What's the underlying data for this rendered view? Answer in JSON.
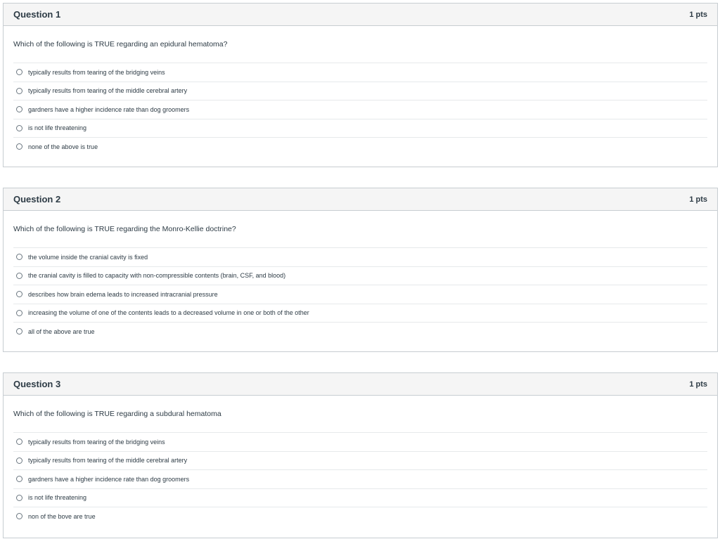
{
  "questions": [
    {
      "title": "Question 1",
      "points": "1 pts",
      "text": "Which of the following is TRUE regarding an epidural hematoma?",
      "answers": [
        "typically results from tearing of the bridging veins",
        "typically results from tearing of the middle cerebral artery",
        "gardners have a higher incidence rate than dog groomers",
        "is not life threatening",
        "none of the above is true"
      ]
    },
    {
      "title": "Question 2",
      "points": "1 pts",
      "text": "Which of the following is TRUE regarding the Monro-Kellie doctrine?",
      "answers": [
        "the volume inside the cranial cavity is fixed",
        "the cranial cavity is filled to capacity with non-compressible contents (brain, CSF, and blood)",
        "describes how brain edema leads to increased intracranial pressure",
        "increasing the volume of one of the contents leads to a decreased volume in one or both of the other",
        "all of the above are true"
      ]
    },
    {
      "title": "Question 3",
      "points": "1 pts",
      "text": "Which of the following is TRUE regarding a subdural hematoma",
      "answers": [
        "typically results from tearing of the bridging veins",
        "typically results from tearing of the middle cerebral artery",
        "gardners have a higher incidence rate than dog groomers",
        "is not life threatening",
        "non of the bove are true"
      ]
    }
  ]
}
